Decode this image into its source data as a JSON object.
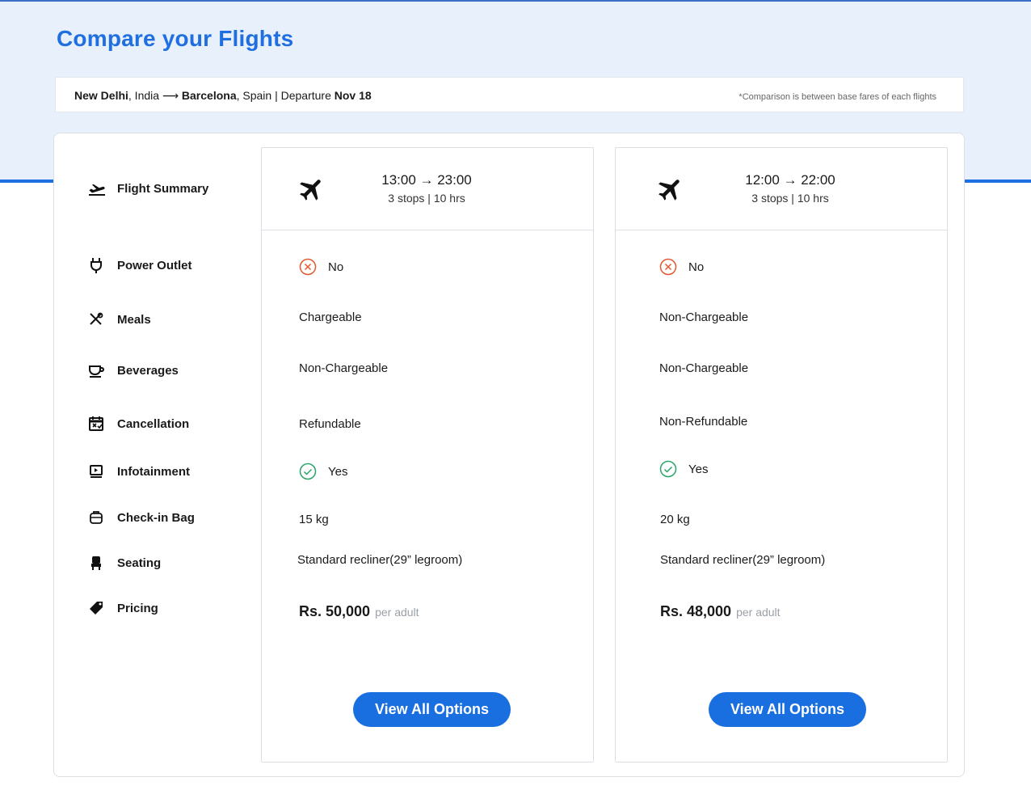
{
  "page": {
    "title": "Compare your Flights"
  },
  "route": {
    "origin_city": "New Delhi",
    "origin_country": ", India ",
    "arrow": "⟶",
    "dest_city": "Barcelona",
    "dest_country": ", Spain | Departure ",
    "departure_date": "Nov 18",
    "note": "*Comparison is between base fares of each flights"
  },
  "labels": [
    {
      "label": "Flight Summary",
      "icon": "flight-departure-icon"
    },
    {
      "label": "Power Outlet",
      "icon": "power-plug-icon"
    },
    {
      "label": "Meals",
      "icon": "fork-knife-icon"
    },
    {
      "label": "Beverages",
      "icon": "coffee-cup-icon"
    },
    {
      "label": "Cancellation",
      "icon": "calendar-cancel-icon"
    },
    {
      "label": "Infotainment",
      "icon": "screen-play-icon"
    },
    {
      "label": "Check-in Bag",
      "icon": "luggage-icon"
    },
    {
      "label": "Seating",
      "icon": "seat-icon"
    },
    {
      "label": "Pricing",
      "icon": "price-tag-icon"
    }
  ],
  "flights": [
    {
      "times": "13:00 → 23:00",
      "stops": "3 stops | 10 hrs",
      "power_outlet": "No",
      "meals": "Chargeable",
      "beverages": "Non-Chargeable",
      "cancellation": "Refundable",
      "infotainment": "Yes",
      "checkin_bag": "15 kg",
      "seating": "Standard recliner(29” legroom)",
      "price": "Rs. 50,000",
      "price_unit": "per adult",
      "button": "View All Options"
    },
    {
      "times": "12:00 → 22:00",
      "stops": "3 stops | 10 hrs",
      "power_outlet": "No",
      "meals": "Non-Chargeable",
      "beverages": "Non-Chargeable",
      "cancellation": "Non-Refundable",
      "infotainment": "Yes",
      "checkin_bag": "20 kg",
      "seating": "Standard recliner(29” legroom)",
      "price": "Rs. 48,000",
      "price_unit": "per adult",
      "button": "View All Options"
    }
  ],
  "colors": {
    "accent": "#1f6fe0",
    "band": "#e8f0fc",
    "no": "#e4572e",
    "yes": "#2aa56a"
  }
}
